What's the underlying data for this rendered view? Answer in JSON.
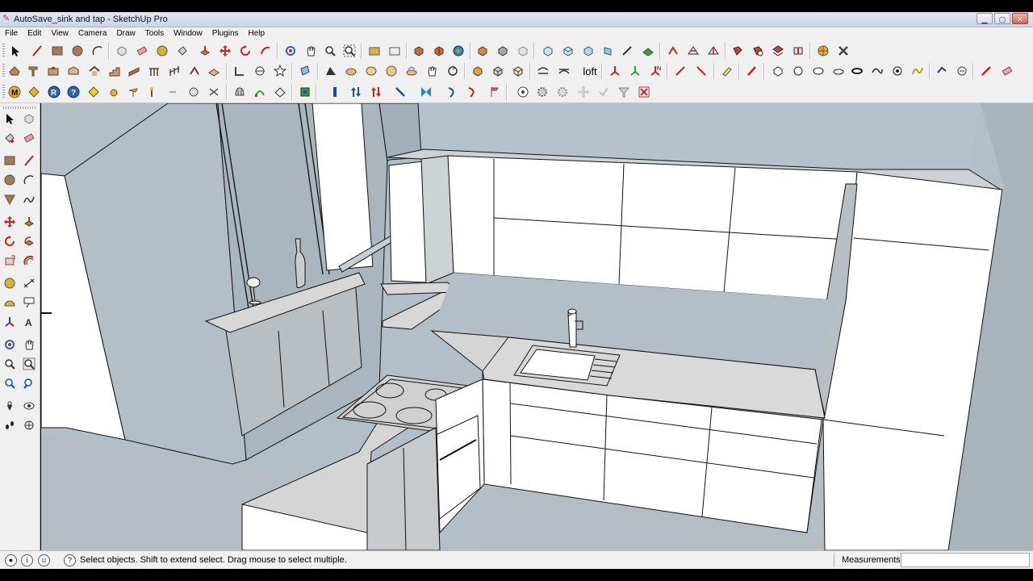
{
  "window": {
    "title": "AutoSave_sink and tap - SketchUp Pro"
  },
  "menu": [
    "File",
    "Edit",
    "View",
    "Camera",
    "Draw",
    "Tools",
    "Window",
    "Plugins",
    "Help"
  ],
  "toolbar": {
    "loft_label": "loft"
  },
  "status": {
    "hint": "Select objects. Shift to extend select. Drag mouse to select multiple."
  },
  "measurements": {
    "label": "Measurements",
    "value": ""
  },
  "colors": {
    "viewport_bg": "#b3bec6",
    "model_face": "#ffffff",
    "wall_grey": "#b9bec2",
    "counter_grey": "#d7d7d7",
    "edge": "#111111"
  }
}
